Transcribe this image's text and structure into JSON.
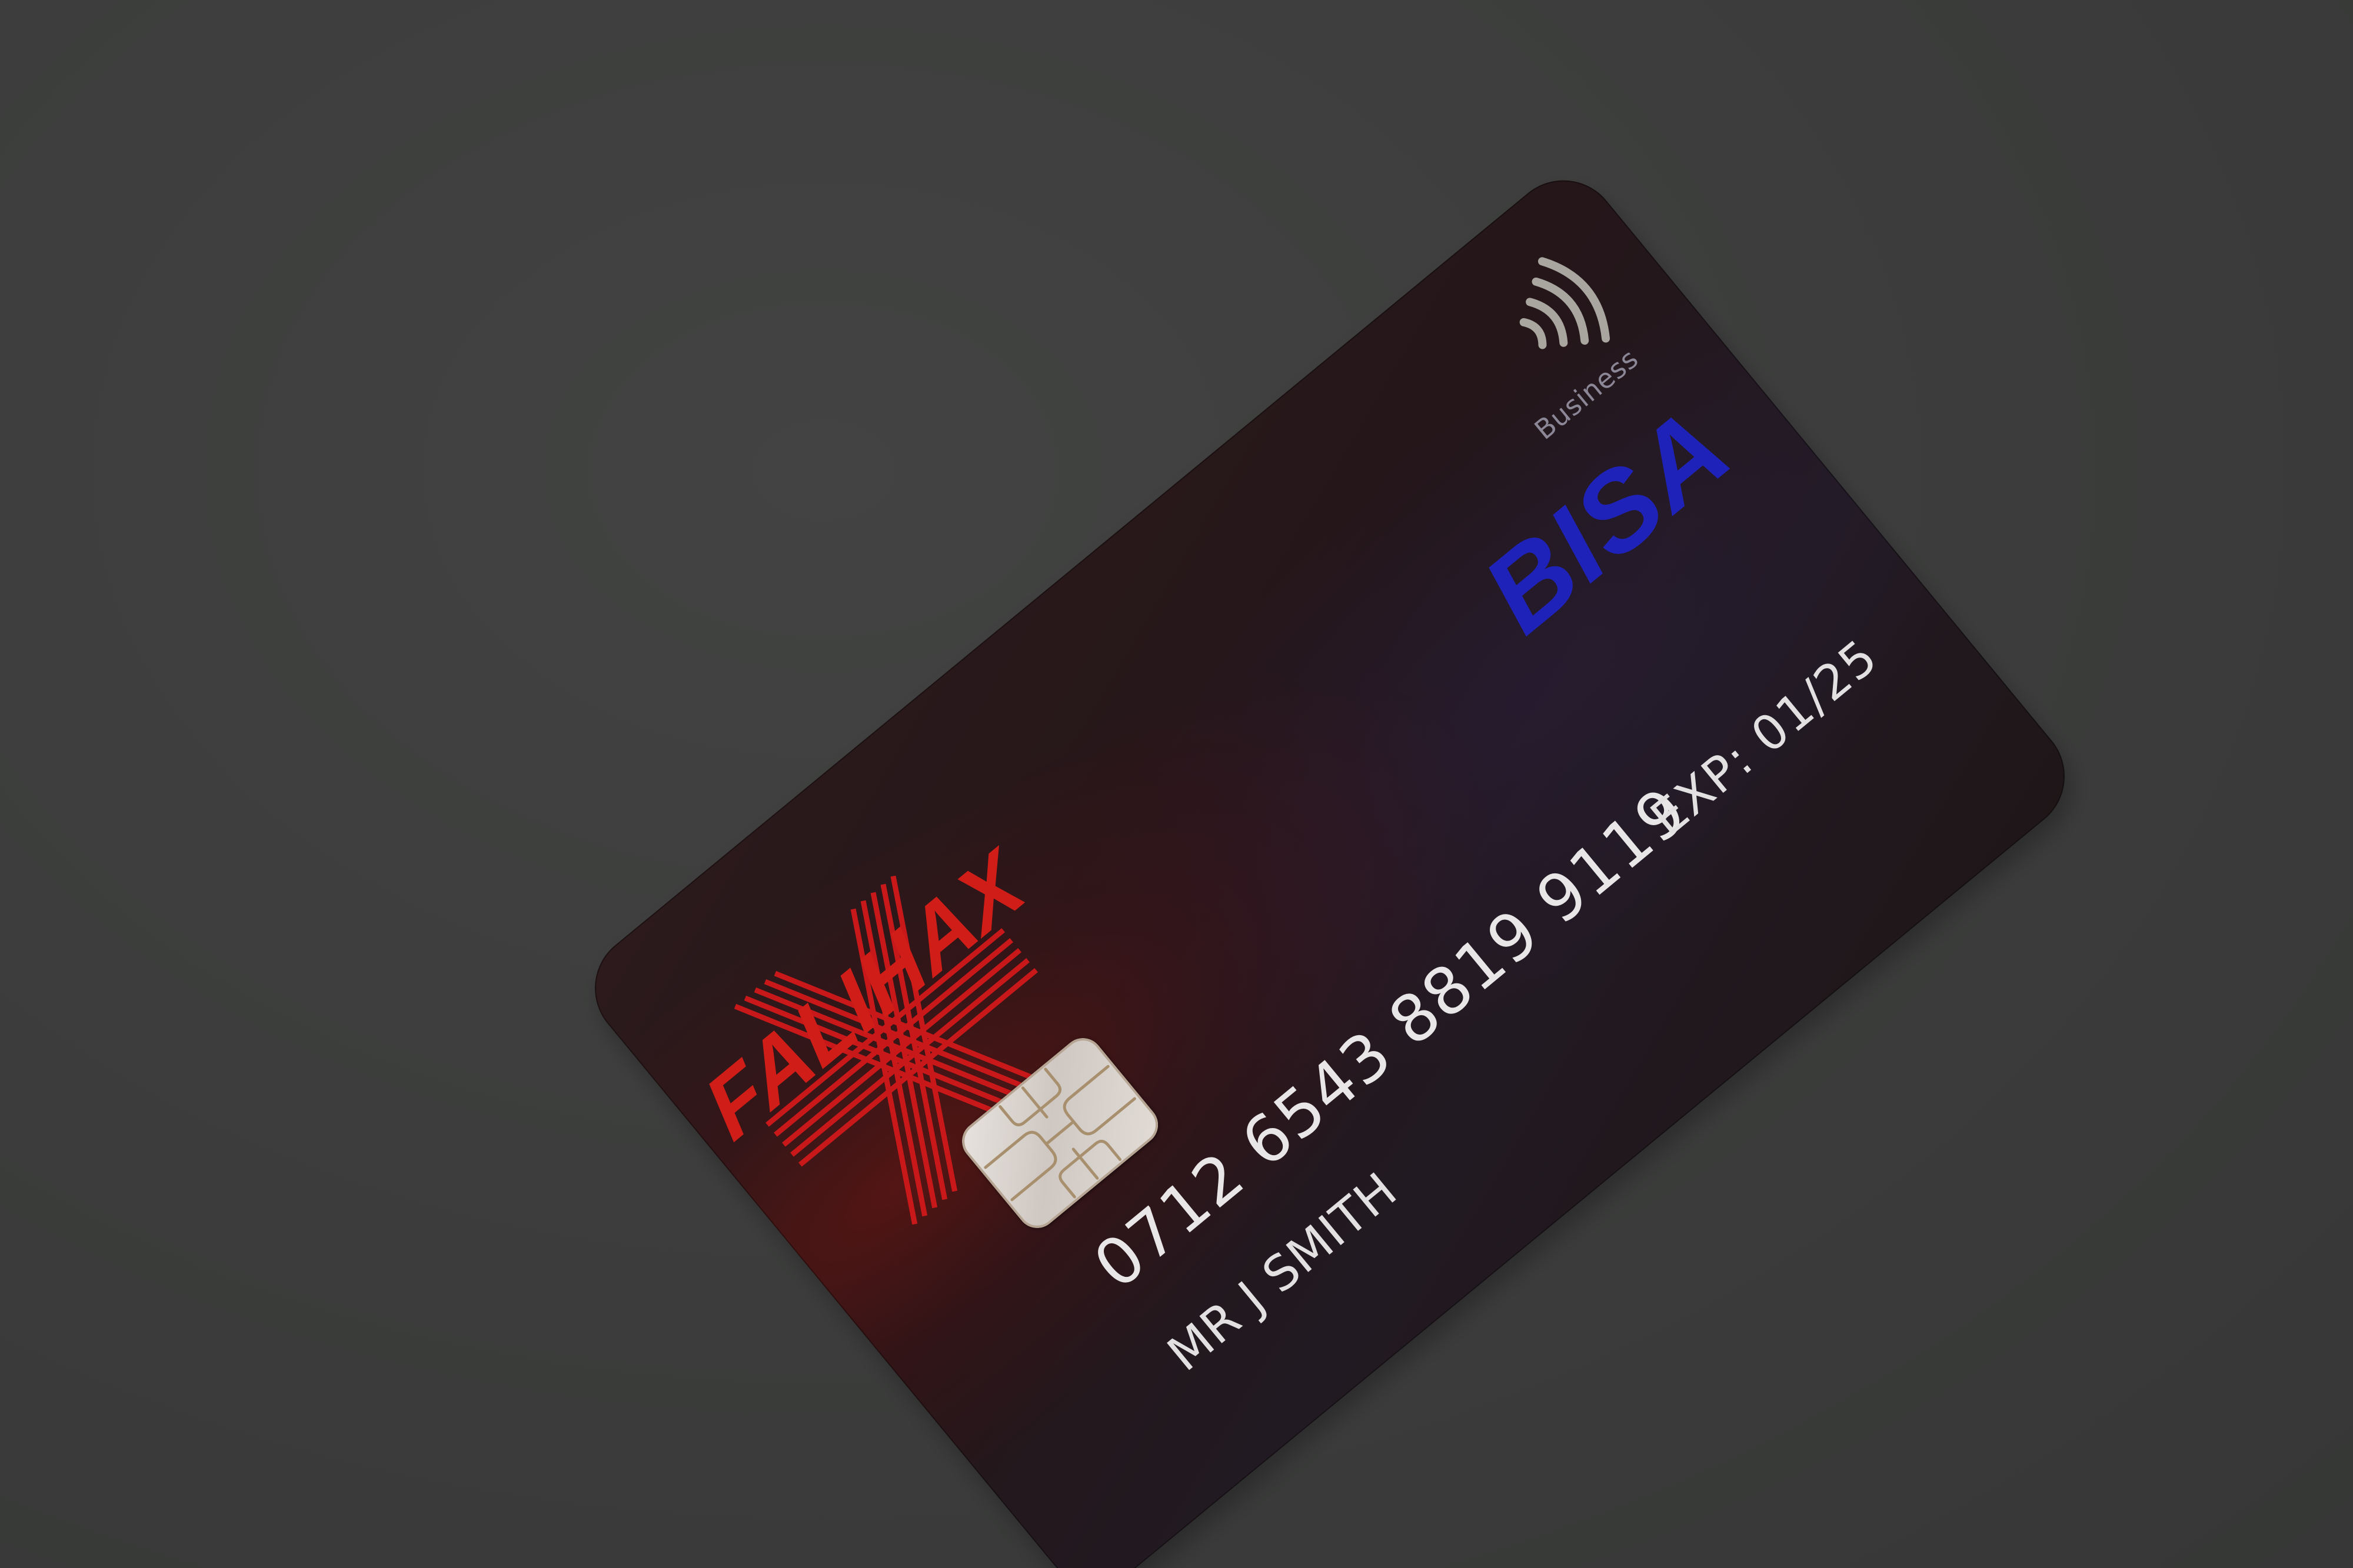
{
  "card": {
    "bank_name": "FALIHAX",
    "tier": "Business",
    "network": "BISA",
    "number": "0712 6543 8819 9119",
    "holder": "MR J SMITH",
    "expiry": "EXP: 01/25"
  },
  "colors": {
    "background": "#3b3c3b",
    "card_base": "#241619",
    "logo_red": "#d11d18",
    "network_blue": "#1f22b8",
    "print_light": "#e8e6e6",
    "tier_grey": "#8c8796"
  },
  "icons": [
    "contactless-icon",
    "emv-chip-icon",
    "bank-logo-stripes-icon"
  ]
}
